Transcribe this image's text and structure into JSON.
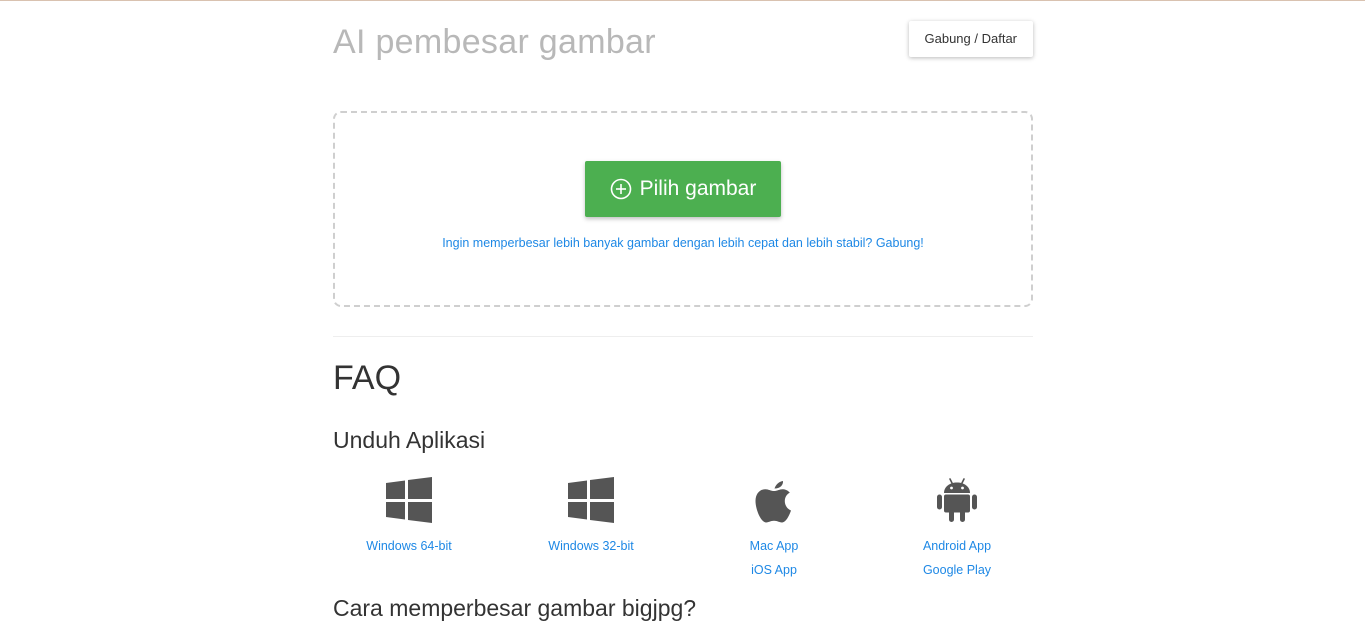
{
  "header": {
    "title": "AI pembesar gambar",
    "join_label": "Gabung / Daftar"
  },
  "upload": {
    "pick_label": "Pilih gambar",
    "faster_link": "Ingin memperbesar lebih banyak gambar dengan lebih cepat dan lebih stabil? Gabung!"
  },
  "faq": {
    "title": "FAQ",
    "download_title": "Unduh Aplikasi",
    "apps": [
      {
        "icon": "windows-icon",
        "link1": "Windows 64-bit"
      },
      {
        "icon": "windows-icon",
        "link1": "Windows 32-bit"
      },
      {
        "icon": "apple-icon",
        "link1": "Mac App",
        "link2": "iOS App"
      },
      {
        "icon": "android-icon",
        "link1": "Android App",
        "link2": "Google Play"
      }
    ],
    "howto_title": "Cara memperbesar gambar bigjpg?"
  },
  "colors": {
    "accent_green": "#4caf50",
    "link_blue": "#1e88e5",
    "title_gray": "#b8b8b8",
    "icon_gray": "#555555"
  }
}
